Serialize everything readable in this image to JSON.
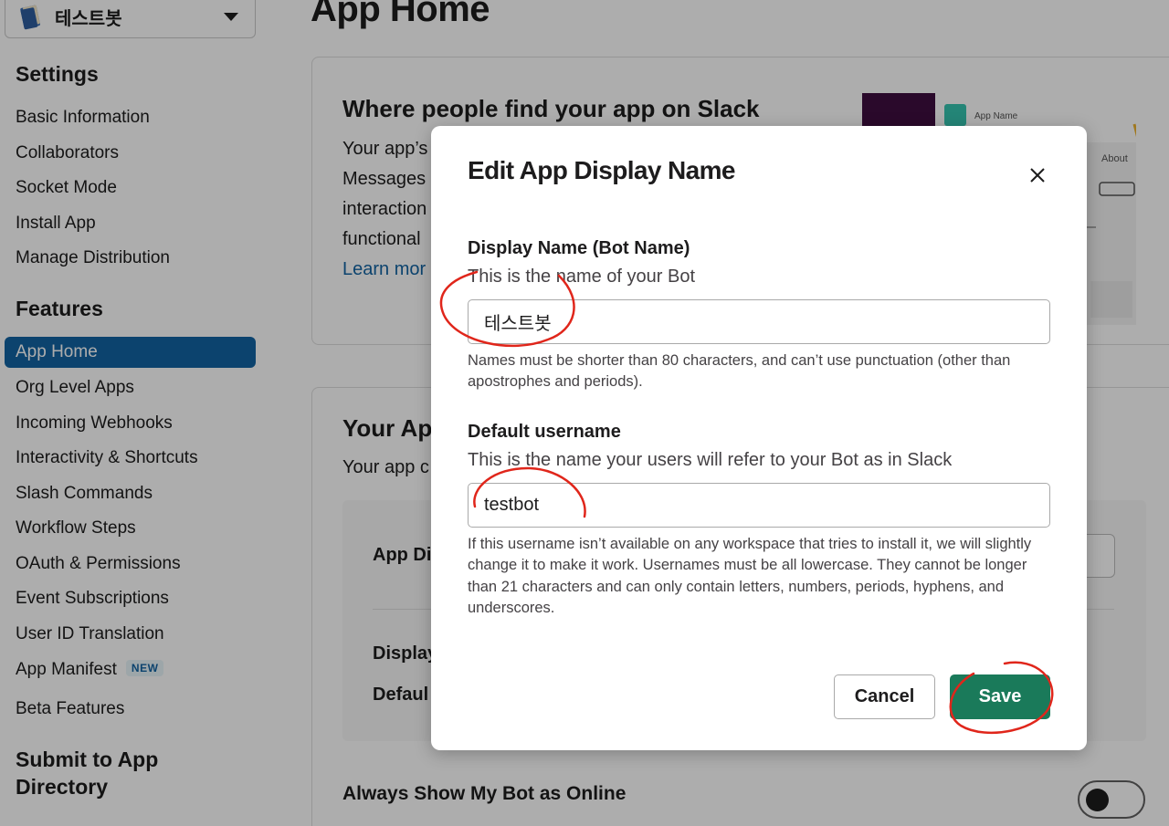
{
  "app_picker": {
    "name": "테스트봇",
    "icon": "book-icon"
  },
  "sidebar": {
    "settings_title": "Settings",
    "settings_items": [
      "Basic Information",
      "Collaborators",
      "Socket Mode",
      "Install App",
      "Manage Distribution"
    ],
    "features_title": "Features",
    "features_items": [
      "App Home",
      "Org Level Apps",
      "Incoming Webhooks",
      "Interactivity & Shortcuts",
      "Slash Commands",
      "Workflow Steps",
      "OAuth & Permissions",
      "Event Subscriptions",
      "User ID Translation",
      "App Manifest",
      "Beta Features"
    ],
    "active_item": "App Home",
    "new_badge": "NEW",
    "submit_title_line1": "Submit to App",
    "submit_title_line2": "Directory"
  },
  "main": {
    "page_title": "App Home",
    "card1": {
      "heading": "Where people find your app on Slack",
      "lines": [
        "Your app’s",
        "Messages",
        "interaction",
        "functional"
      ],
      "learn_more": "Learn mor"
    },
    "preview": {
      "app_name": "App Name",
      "about_tab": "About"
    },
    "card2": {
      "heading": "Your Ap",
      "subtext": "Your app c",
      "row1": "App Di",
      "row2": "Display",
      "row3": "Defaul"
    },
    "always_online": "Always Show My Bot as Online"
  },
  "modal": {
    "title": "Edit App Display Name",
    "display_name": {
      "label": "Display Name (Bot Name)",
      "hint": "This is the name of your Bot",
      "value": "테스트봇",
      "help": "Names must be shorter than 80 characters, and can’t use punctuation (other than apostrophes and periods)."
    },
    "default_username": {
      "label": "Default username",
      "hint": "This is the name your users will refer to your Bot as in Slack",
      "value": "testbot",
      "help": "If this username isn’t available on any workspace that tries to install it, we will slightly change it to make it work. Usernames must be all lowercase. They cannot be longer than 21 characters and can only contain letters, numbers, periods, hyphens, and underscores."
    },
    "cancel_label": "Cancel",
    "save_label": "Save"
  },
  "colors": {
    "accent_blue": "#1264a3",
    "save_green": "#1a7a5a",
    "annotation_red": "#e0261b"
  }
}
